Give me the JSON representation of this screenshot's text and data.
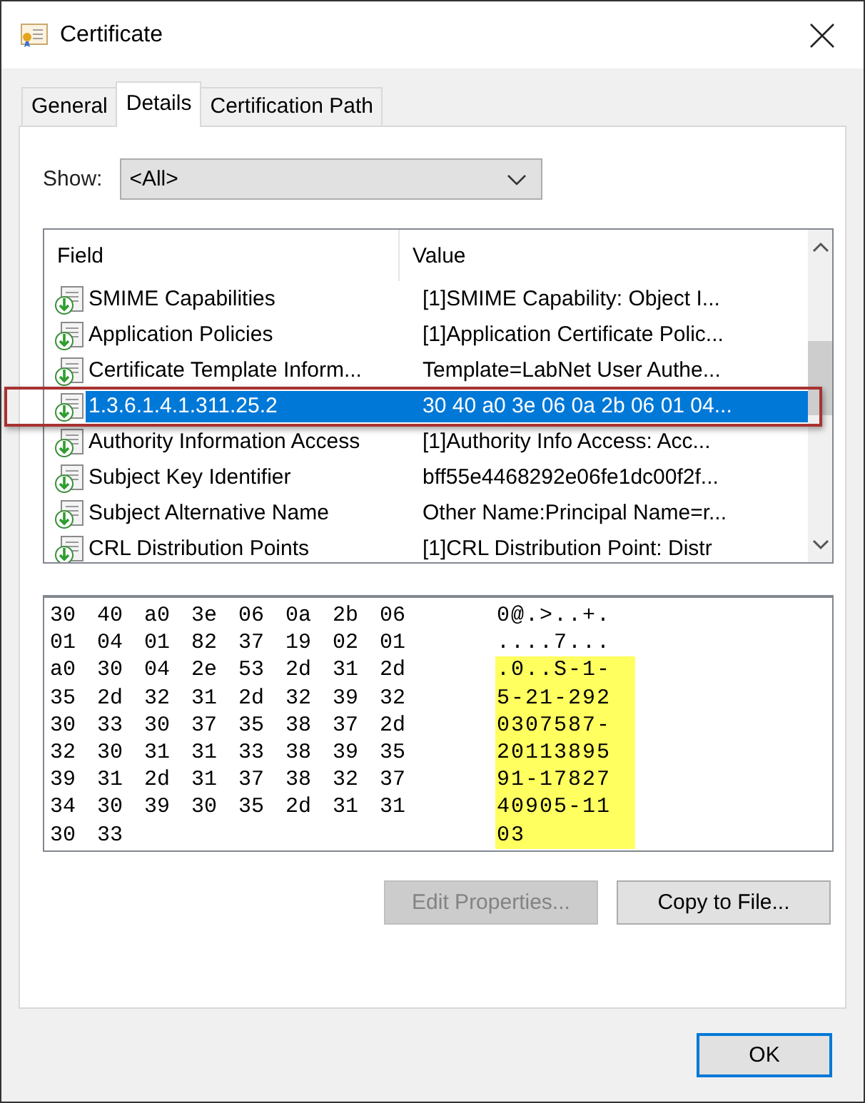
{
  "window": {
    "title": "Certificate"
  },
  "tabs": [
    {
      "label": "General",
      "selected": false
    },
    {
      "label": "Details",
      "selected": true
    },
    {
      "label": "Certification Path",
      "selected": false
    }
  ],
  "show": {
    "label": "Show:",
    "value": "<All>"
  },
  "fields_table": {
    "columns": [
      "Field",
      "Value"
    ],
    "rows": [
      {
        "field": "SMIME Capabilities",
        "value": "[1]SMIME Capability: Object I...",
        "selected": false
      },
      {
        "field": "Application Policies",
        "value": "[1]Application Certificate Polic...",
        "selected": false
      },
      {
        "field": "Certificate Template Inform...",
        "value": "Template=LabNet User Authe...",
        "selected": false
      },
      {
        "field": "1.3.6.1.4.1.311.25.2",
        "value": "30 40 a0 3e 06 0a 2b 06 01 04...",
        "selected": true
      },
      {
        "field": "Authority Information Access",
        "value": "[1]Authority Info Access: Acc...",
        "selected": false
      },
      {
        "field": "Subject Key Identifier",
        "value": "bff55e4468292e06fe1dc00f2f...",
        "selected": false
      },
      {
        "field": "Subject Alternative Name",
        "value": "Other Name:Principal Name=r...",
        "selected": false
      },
      {
        "field": "CRL Distribution Points",
        "value": "[1]CRL Distribution Point: Distr",
        "selected": false
      }
    ]
  },
  "hex_dump": [
    {
      "hex": "30 40 a0 3e 06 0a 2b 06",
      "ascii": "0@.>..+.",
      "highlighted": false
    },
    {
      "hex": "01 04 01 82 37 19 02 01",
      "ascii": "....7...",
      "highlighted": false
    },
    {
      "hex": "a0 30 04 2e 53 2d 31 2d",
      "ascii": ".0..S-1-",
      "highlighted": true
    },
    {
      "hex": "35 2d 32 31 2d 32 39 32",
      "ascii": "5-21-292",
      "highlighted": true
    },
    {
      "hex": "30 33 30 37 35 38 37 2d",
      "ascii": "0307587-",
      "highlighted": true
    },
    {
      "hex": "32 30 31 31 33 38 39 35",
      "ascii": "20113895",
      "highlighted": true
    },
    {
      "hex": "39 31 2d 31 37 38 32 37",
      "ascii": "91-17827",
      "highlighted": true
    },
    {
      "hex": "34 30 39 30 35 2d 31 31",
      "ascii": "40905-11",
      "highlighted": true
    },
    {
      "hex": "30 33",
      "ascii": "03",
      "highlighted": true
    }
  ],
  "panel_buttons": [
    {
      "label": "Edit Properties...",
      "disabled": true
    },
    {
      "label": "Copy to File...",
      "disabled": false
    }
  ],
  "dialog_buttons": [
    {
      "label": "OK",
      "default": true
    }
  ]
}
